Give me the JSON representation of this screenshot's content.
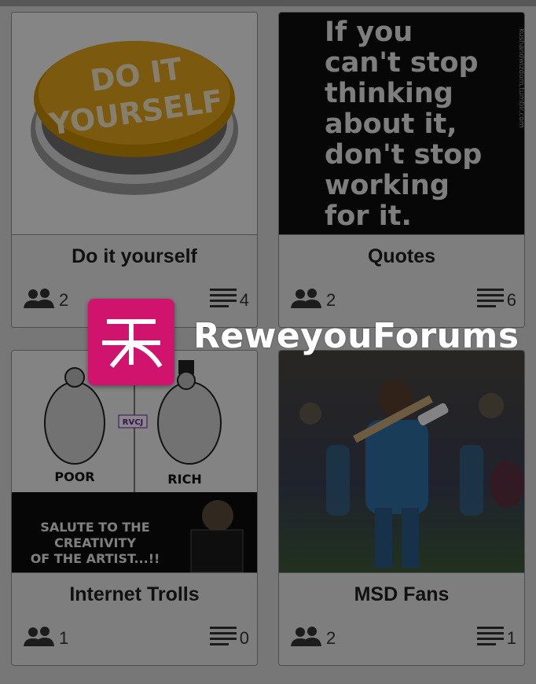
{
  "brand": {
    "name": "ReweyouForums",
    "logo_color": "#d0136c"
  },
  "cards": [
    {
      "title": "Do it yourself",
      "members": "2",
      "topics": "4",
      "image_text": [
        "DO IT",
        "YOURSELF"
      ]
    },
    {
      "title": "Quotes",
      "members": "2",
      "topics": "6",
      "image_text": [
        "If you",
        "can't stop",
        "thinking",
        "about it,",
        "don't stop",
        "working",
        "for it."
      ],
      "image_watermark": "kushandwizdom.tumblr.com"
    },
    {
      "title": "Internet Trolls",
      "members": "1",
      "topics": "0",
      "image_text": [
        "POOR",
        "RICH",
        "SALUTE TO THE",
        "CREATIVITY",
        "OF THE ARTIST...!!",
        "RVCJ"
      ]
    },
    {
      "title": "MSD Fans",
      "members": "2",
      "topics": "1"
    }
  ],
  "icons": {
    "members": "people-icon",
    "topics": "list-icon"
  }
}
